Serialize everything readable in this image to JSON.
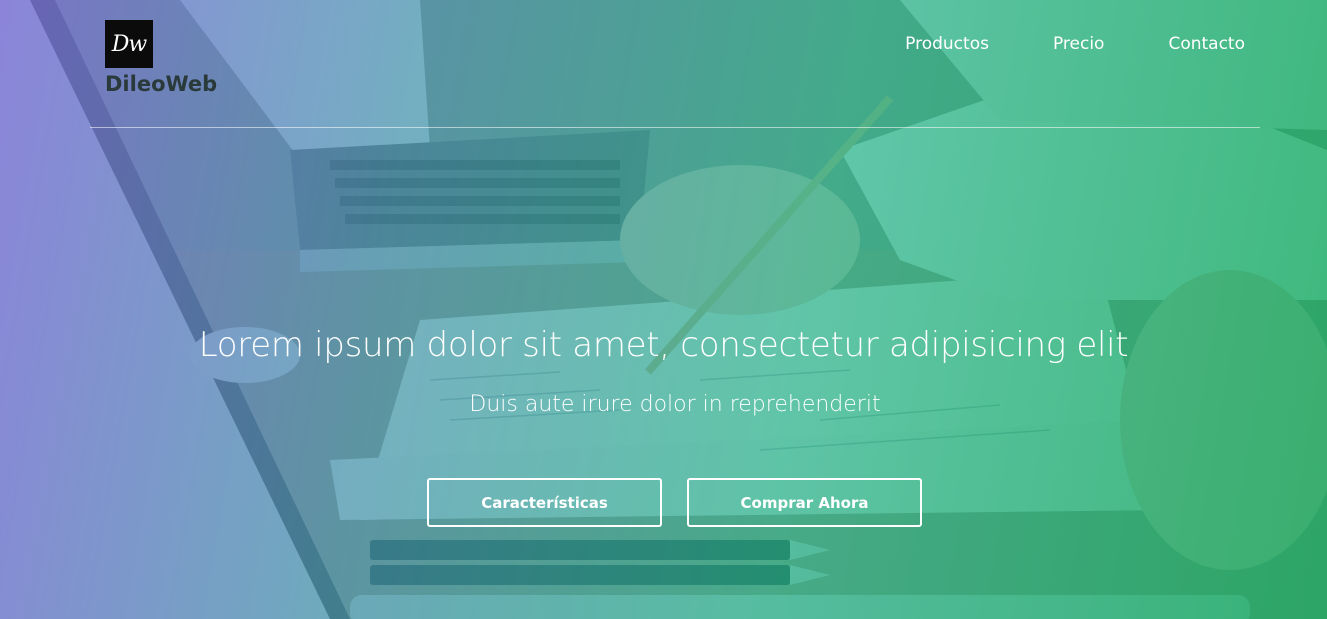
{
  "brand": {
    "logo_mark": "Dw",
    "name": "DileoWeb"
  },
  "nav": {
    "items": [
      {
        "label": "Productos"
      },
      {
        "label": "Precio"
      },
      {
        "label": "Contacto"
      }
    ]
  },
  "hero": {
    "headline": "Lorem ipsum dolor sit amet, consectetur adipisicing elit",
    "subheadline": "Duis aute irure dolor in reprehenderit",
    "buttons": {
      "features_label": "Características",
      "buy_label": "Comprar Ahora"
    }
  },
  "colors": {
    "overlay_left": "#786ed7",
    "overlay_mid": "#28b48c",
    "overlay_right": "#14aa5f",
    "logo_bg": "#0b0b0b",
    "text": "#ffffff"
  }
}
